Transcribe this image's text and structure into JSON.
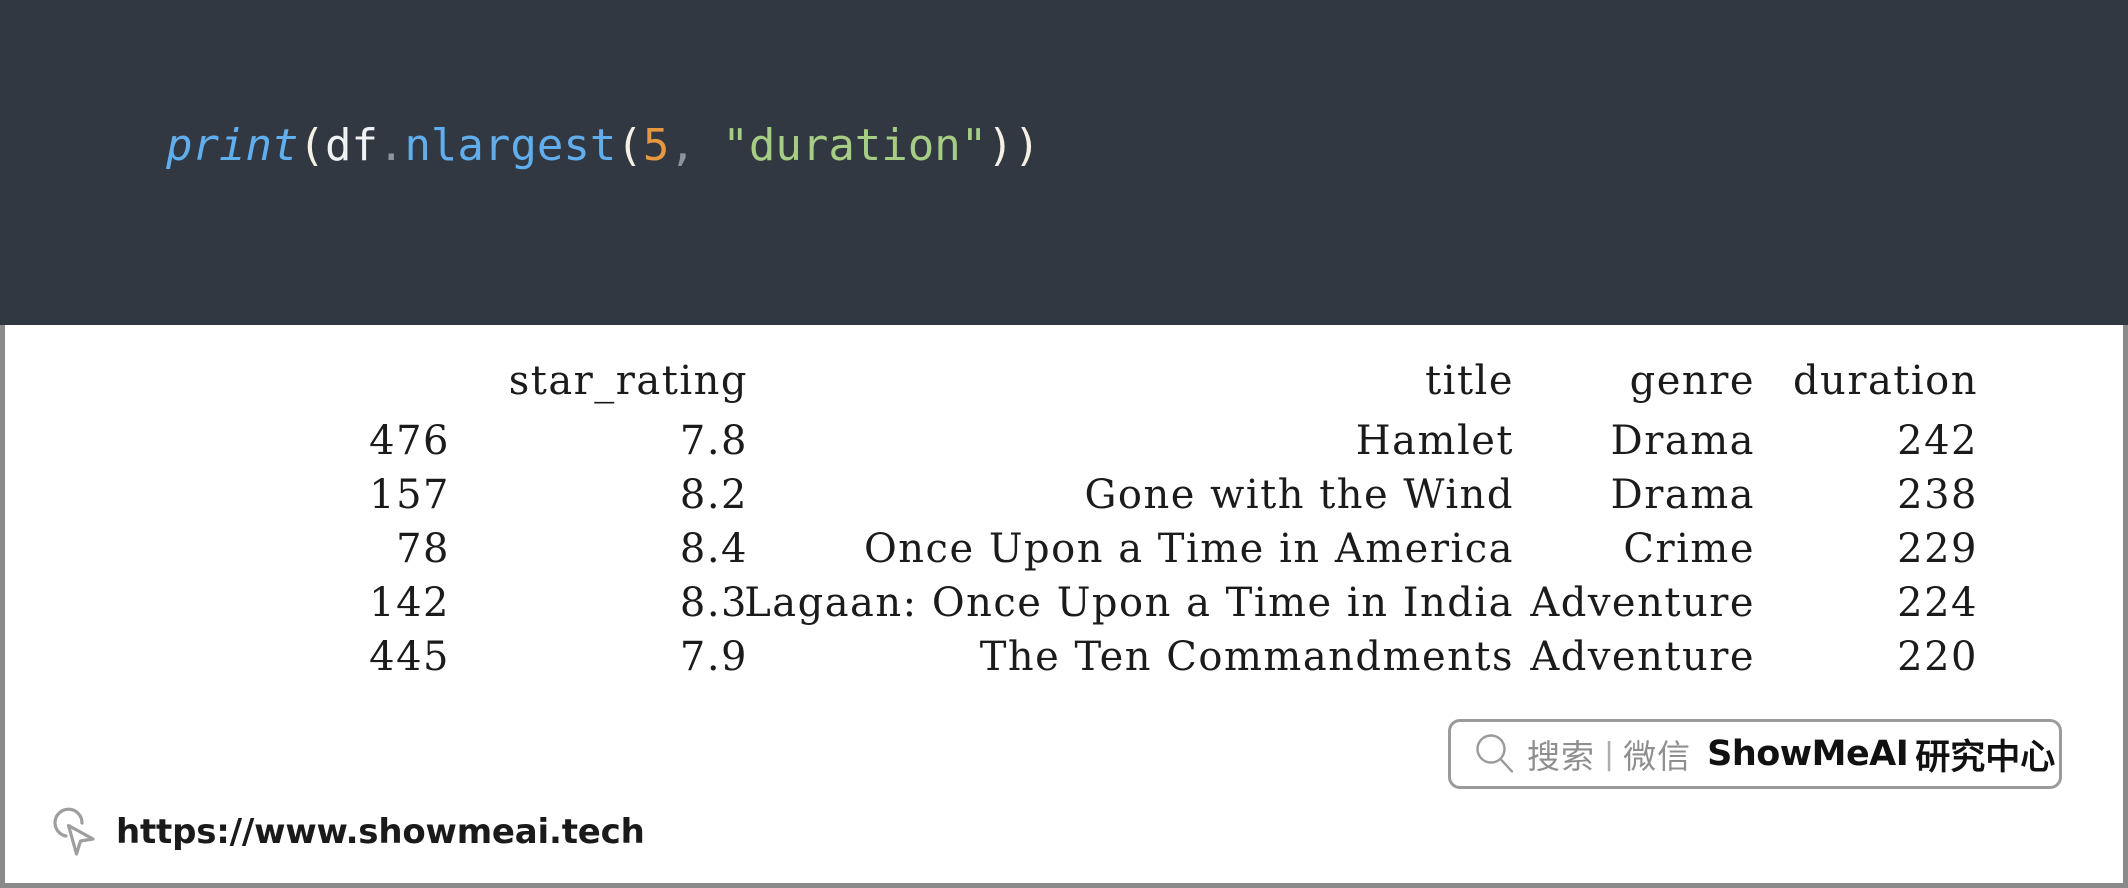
{
  "code": {
    "language": "python",
    "tokens": [
      {
        "text": "print",
        "type": "function"
      },
      {
        "text": "(",
        "type": "paren"
      },
      {
        "text": "df",
        "type": "variable"
      },
      {
        "text": ".",
        "type": "dot"
      },
      {
        "text": "nlargest",
        "type": "method"
      },
      {
        "text": "(",
        "type": "paren"
      },
      {
        "text": "5",
        "type": "number"
      },
      {
        "text": ",",
        "type": "comma"
      },
      {
        "text": " ",
        "type": "plain"
      },
      {
        "text": "\"duration\"",
        "type": "string"
      },
      {
        "text": ")",
        "type": "paren"
      },
      {
        "text": ")",
        "type": "paren"
      }
    ],
    "full_line": "print(df.nlargest(5, \"duration\"))",
    "background_color": "#313841"
  },
  "output": {
    "columns": [
      "",
      "star_rating",
      "title",
      "genre",
      "duration"
    ],
    "rows": [
      {
        "index": "476",
        "star_rating": "7.8",
        "title": "Hamlet",
        "genre": "Drama",
        "duration": "242"
      },
      {
        "index": "157",
        "star_rating": "8.2",
        "title": "Gone with the Wind",
        "genre": "Drama",
        "duration": "238"
      },
      {
        "index": "78",
        "star_rating": "8.4",
        "title": "Once Upon a Time in America",
        "genre": "Crime",
        "duration": "229"
      },
      {
        "index": "142",
        "star_rating": "8.3",
        "title": "Lagaan: Once Upon a Time in India",
        "genre": "Adventure",
        "duration": "224"
      },
      {
        "index": "445",
        "star_rating": "7.9",
        "title": "The Ten Commandments",
        "genre": "Adventure",
        "duration": "220"
      }
    ]
  },
  "badge": {
    "search_icon": "magnifier-icon",
    "search_label": "搜索",
    "separator": "|",
    "channel_label": "微信",
    "brand": "ShowMeAI",
    "brand_cn": "研究中心"
  },
  "footer": {
    "cursor_icon": "cursor-pointer-icon",
    "url": "https://www.showmeai.tech"
  }
}
